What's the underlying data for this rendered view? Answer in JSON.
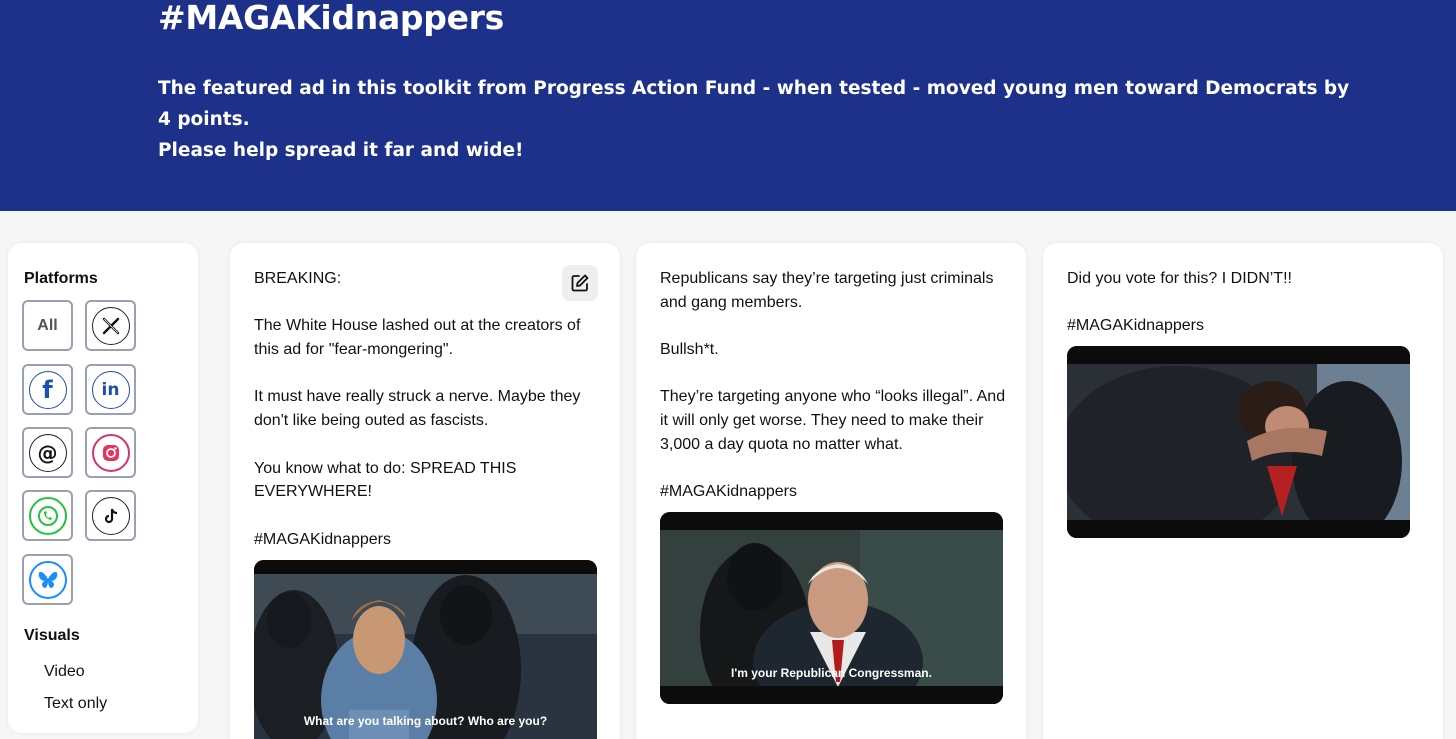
{
  "banner": {
    "title": "#MAGAKidnappers",
    "desc_line1": "The featured ad in this toolkit from Progress Action Fund - when tested - moved young men toward Democrats by 4 points.",
    "desc_line2": "Please help spread it far and wide!",
    "bg_color": "#1d318a"
  },
  "sidebar": {
    "platforms_heading": "Platforms",
    "platforms": [
      {
        "label": "All",
        "icon": "all-filter"
      },
      {
        "label": "X",
        "icon": "x-icon"
      },
      {
        "label": "f",
        "icon": "facebook-icon"
      },
      {
        "label": "in",
        "icon": "linkedin-icon"
      },
      {
        "label": "@",
        "icon": "threads-icon"
      },
      {
        "label": "instagram",
        "icon": "instagram-icon"
      },
      {
        "label": "whatsapp",
        "icon": "whatsapp-icon"
      },
      {
        "label": "tiktok",
        "icon": "tiktok-icon"
      },
      {
        "label": "bluesky",
        "icon": "bluesky-icon"
      }
    ],
    "visuals_heading": "Visuals",
    "visuals": [
      "Video",
      "Text only"
    ]
  },
  "cards": [
    {
      "paragraphs": [
        "BREAKING:",
        "The White House lashed out at the creators of this ad for \"fear-mongering\".",
        "It must have really struck a nerve. Maybe they don't like being outed as fascists.",
        "You know what to do: SPREAD THIS EVERYWHERE!",
        "#MAGAKidnappers"
      ],
      "video_caption": "What are you talking about? Who are you?"
    },
    {
      "paragraphs": [
        "Republicans say they’re targeting just criminals and gang members.",
        "Bullsh*t.",
        "They’re targeting anyone who “looks illegal”. And it will only get worse. They need to make their 3,000 a day quota no matter what.",
        "#MAGAKidnappers"
      ],
      "video_caption": "I'm your Republican Congressman."
    },
    {
      "paragraphs": [
        "Did you vote for this? I DIDN’T!!",
        "#MAGAKidnappers"
      ],
      "video_caption": ""
    }
  ]
}
